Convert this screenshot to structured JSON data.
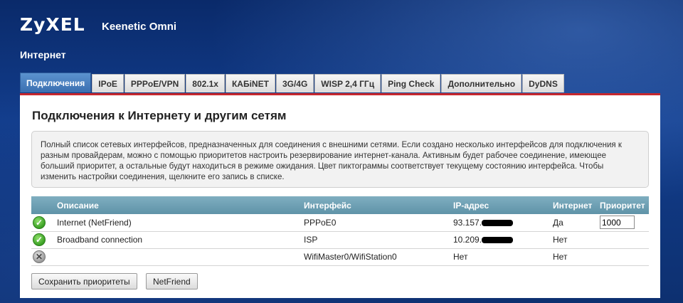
{
  "header": {
    "logo": "ZyXEL",
    "product": "Keenetic Omni",
    "section_title": "Интернет"
  },
  "tabs": [
    {
      "label": "Подключения",
      "active": true
    },
    {
      "label": "IPoE",
      "active": false
    },
    {
      "label": "PPPoE/VPN",
      "active": false
    },
    {
      "label": "802.1x",
      "active": false
    },
    {
      "label": "КАБiNET",
      "active": false
    },
    {
      "label": "3G/4G",
      "active": false
    },
    {
      "label": "WISP 2,4 ГГц",
      "active": false
    },
    {
      "label": "Ping Check",
      "active": false
    },
    {
      "label": "Дополнительно",
      "active": false
    },
    {
      "label": "DyDNS",
      "active": false
    }
  ],
  "panel": {
    "title": "Подключения к Интернету и другим сетям",
    "info": "Полный список сетевых интерфейсов, предназначенных для соединения с внешними сетями. Если создано несколько интерфейсов для подключения к разным провайдерам, можно с помощью приоритетов настроить резервирование интернет-канала. Активным будет рабочее соединение, имеющее больший приоритет, а остальные будут находиться в режиме ожидания. Цвет пиктограммы соответствует текущему состоянию интерфейса. Чтобы изменить настройки соединения, щелкните его запись в списке."
  },
  "table": {
    "headers": {
      "description": "Описание",
      "interface": "Интерфейс",
      "ip": "IP-адрес",
      "internet": "Интернет",
      "priority": "Приоритет"
    },
    "rows": [
      {
        "status": "ok",
        "description": "Internet (NetFriend)",
        "interface": "PPPoE0",
        "ip_visible": "93.157.",
        "internet": "Да",
        "priority": "1000"
      },
      {
        "status": "ok",
        "description": "Broadband connection",
        "interface": "ISP",
        "ip_visible": "10.209.",
        "internet": "Нет",
        "priority": ""
      },
      {
        "status": "off",
        "description": "",
        "interface": "WifiMaster0/WifiStation0",
        "ip_visible": "Нет",
        "internet": "Нет",
        "priority": ""
      }
    ]
  },
  "buttons": {
    "save_priorities": "Сохранить приоритеты",
    "netfriend": "NetFriend"
  },
  "colors": {
    "accent_red": "#c7282e",
    "table_header": "#6fa0b4",
    "active_tab": "#4a80c0",
    "status_ok": "#3aa024"
  }
}
